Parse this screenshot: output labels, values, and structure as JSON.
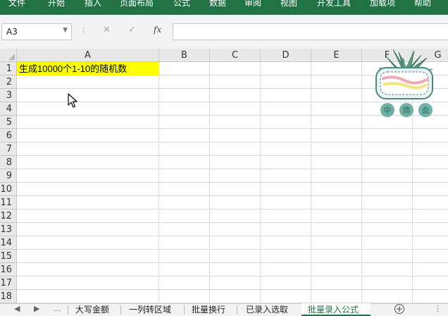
{
  "ribbon": {
    "tabs": [
      "文件",
      "开始",
      "插入",
      "页面布局",
      "公式",
      "数据",
      "审阅",
      "视图",
      "开发工具",
      "加载项",
      "帮助"
    ]
  },
  "formula_bar": {
    "name_box": "A3",
    "fx_label": "fx",
    "cancel_glyph": "✕",
    "enter_glyph": "✓",
    "formula": ""
  },
  "grid": {
    "columns": [
      "A",
      "B",
      "C",
      "D",
      "E",
      "F",
      "G"
    ],
    "rows": [
      "1",
      "2",
      "3",
      "4",
      "5",
      "6",
      "7",
      "8",
      "9",
      "10",
      "11",
      "12",
      "13",
      "14",
      "15",
      "16",
      "17",
      "18"
    ],
    "cells": {
      "A1": "生成10000个1-10的随机数"
    },
    "highlight_color": "#ffff00"
  },
  "logo": {
    "characters": [
      "中",
      "商",
      "会"
    ]
  },
  "sheet_tabs": {
    "nav_prev": "◀",
    "nav_next": "▶",
    "ellipsis": "...",
    "tabs": [
      "大写金额",
      "一列转区域",
      "批量换行",
      "已录入选取",
      "批量录入公式"
    ],
    "active_tab": "批量录入公式",
    "add_label": "+"
  },
  "colors": {
    "accent": "#217346"
  }
}
